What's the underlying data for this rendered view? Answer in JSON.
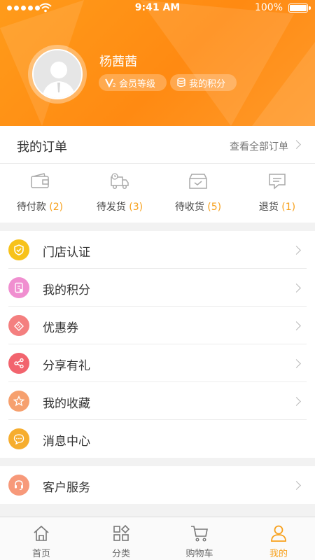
{
  "status_bar": {
    "time": "9:41 AM",
    "battery": "100%"
  },
  "profile": {
    "name": "杨茜茜",
    "level_label": "会员等级",
    "points_label": "我的积分"
  },
  "orders": {
    "title": "我的订单",
    "view_all": "查看全部订单",
    "items": [
      {
        "label": "待付款",
        "count": "(2)",
        "icon": "wallet-icon"
      },
      {
        "label": "待发货",
        "count": "(3)",
        "icon": "delivery-truck-icon"
      },
      {
        "label": "待收货",
        "count": "(5)",
        "icon": "received-box-icon"
      },
      {
        "label": "退货",
        "count": "(1)",
        "icon": "return-message-icon"
      }
    ]
  },
  "menu": [
    {
      "label": "门店认证",
      "icon": "shield-icon",
      "color": "#f7c21b"
    },
    {
      "label": "我的积分",
      "icon": "points-card-icon",
      "color": "#f08fd0"
    },
    {
      "label": "优惠券",
      "icon": "coupon-icon",
      "color": "#f47f7f"
    },
    {
      "label": "分享有礼",
      "icon": "share-icon",
      "color": "#f2646e"
    },
    {
      "label": "我的收藏",
      "icon": "star-icon",
      "color": "#f6a06e"
    },
    {
      "label": "消息中心",
      "icon": "message-icon",
      "color": "#f6ad2e"
    }
  ],
  "service": {
    "label": "客户服务",
    "icon": "headset-icon",
    "color": "#f7997a"
  },
  "tabbar": [
    {
      "label": "首页",
      "icon": "home-icon",
      "active": false
    },
    {
      "label": "分类",
      "icon": "category-icon",
      "active": false
    },
    {
      "label": "购物车",
      "icon": "cart-icon",
      "active": false
    },
    {
      "label": "我的",
      "icon": "user-icon",
      "active": true
    }
  ],
  "colors": {
    "accent": "#f7a01b",
    "header": "#ff8d14"
  }
}
